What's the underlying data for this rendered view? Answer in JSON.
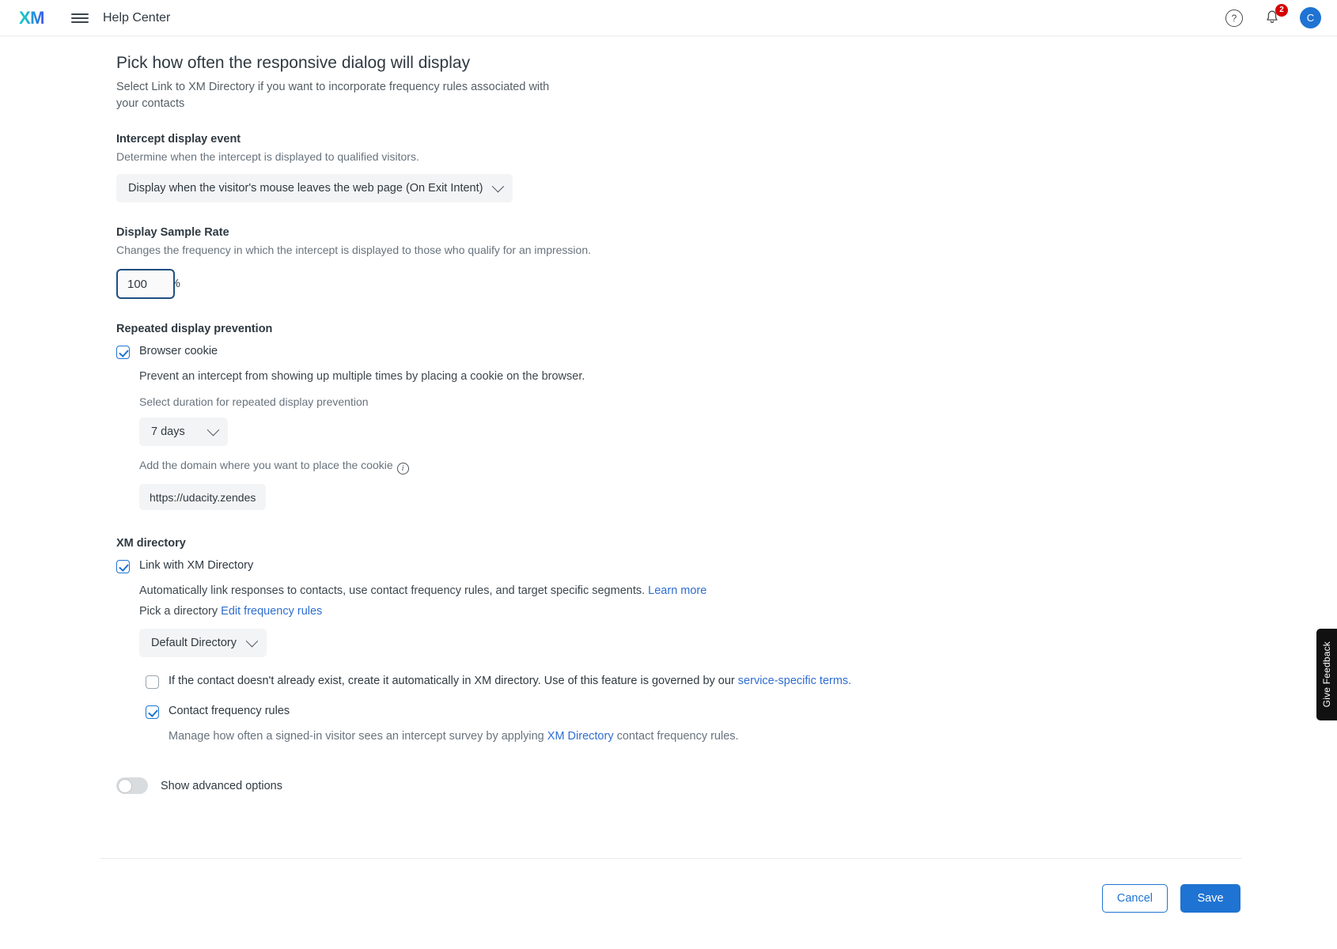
{
  "header": {
    "logo_text": "XM",
    "menu_icon": "hamburger-menu-icon",
    "title": "Help Center",
    "help_icon": "?",
    "notifications_count": "2",
    "avatar_initial": "C"
  },
  "page": {
    "title": "Pick how often the responsive dialog will display",
    "subtitle": "Select Link to XM Directory if you want to incorporate frequency rules associated with your contacts"
  },
  "intercept_display_event": {
    "label": "Intercept display event",
    "description": "Determine when the intercept is displayed to qualified visitors.",
    "selected": "Display when the visitor's mouse leaves the web page (On Exit Intent)"
  },
  "display_sample_rate": {
    "label": "Display Sample Rate",
    "description": "Changes the frequency in which the intercept is displayed to those who qualify for an impression.",
    "value": "100",
    "unit": "%"
  },
  "repeated_display_prevention": {
    "label": "Repeated display prevention",
    "browser_cookie": {
      "label": "Browser cookie",
      "checked": true,
      "description": "Prevent an intercept from showing up multiple times by placing a cookie on the browser.",
      "duration_label": "Select duration for repeated display prevention",
      "duration_value": "7 days",
      "domain_label": "Add the domain where you want to place the cookie",
      "domain_value": "https://udacity.zendesk.com"
    }
  },
  "xm_directory": {
    "label": "XM directory",
    "link_checkbox": {
      "label": "Link with XM Directory",
      "checked": true,
      "description": "Automatically link responses to contacts, use contact frequency rules, and target specific segments.",
      "learn_more": "Learn more",
      "pick_directory_label": "Pick a directory",
      "edit_frequency_rules": "Edit frequency rules",
      "directory_value": "Default Directory"
    },
    "auto_create": {
      "checked": false,
      "text": "If the contact doesn't already exist, create it automatically in XM directory. Use of this feature is governed by our",
      "link": "service-specific terms."
    },
    "contact_frequency_rules": {
      "label": "Contact frequency rules",
      "checked": true,
      "text_before": "Manage how often a signed-in visitor sees an intercept survey by applying",
      "link": "XM Directory",
      "text_after": "contact frequency rules."
    }
  },
  "advanced": {
    "toggle_label": "Show advanced options",
    "enabled": false
  },
  "footer": {
    "cancel_label": "Cancel",
    "save_label": "Save"
  },
  "feedback_tab": {
    "label": "Give Feedback"
  },
  "colors": {
    "accent": "#1f73d2",
    "link": "#2f6dd0",
    "badge": "#d50000",
    "focus_border": "#1f4f82"
  }
}
